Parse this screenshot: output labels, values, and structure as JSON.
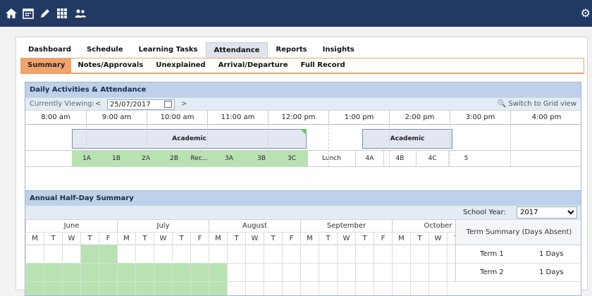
{
  "app": {
    "toolbar_icons": [
      "home-icon",
      "calendar-icon",
      "pencil-icon",
      "grid-icon",
      "people-icon",
      "gear-icon"
    ]
  },
  "tabs": [
    "Dashboard",
    "Schedule",
    "Learning Tasks",
    "Attendance",
    "Reports",
    "Insights"
  ],
  "active_tab": "Attendance",
  "subtabs": [
    "Summary",
    "Notes/Approvals",
    "Unexplained",
    "Arrival/Departure",
    "Full Record"
  ],
  "active_subtab": "Summary",
  "daily": {
    "title": "Daily Activities & Attendance",
    "viewing_label": "Currently Viewing:",
    "prev": "<",
    "next": ">",
    "date_value": "25/07/2017",
    "grid_link": "Switch to Grid view",
    "hours": [
      "8:00 am",
      "9:00 am",
      "10:00 am",
      "11:00 am",
      "12:00 pm",
      "1:00 pm",
      "2:00 pm",
      "3:00 pm",
      "4:00 pm"
    ],
    "blocks": [
      "Academic",
      "Academic"
    ],
    "periods": [
      {
        "label": "1A",
        "attended": true
      },
      {
        "label": "1B",
        "attended": true
      },
      {
        "label": "2A",
        "attended": true
      },
      {
        "label": "2B",
        "attended": true
      },
      {
        "label": "Rec...",
        "attended": true
      },
      {
        "label": "3A",
        "attended": true
      },
      {
        "label": "3B",
        "attended": true
      },
      {
        "label": "3C",
        "attended": true
      },
      {
        "label": "Lunch",
        "attended": false
      },
      {
        "label": "4A",
        "attended": false
      },
      {
        "label": "4B",
        "attended": false
      },
      {
        "label": "4C",
        "attended": false
      },
      {
        "label": "5",
        "attended": false
      }
    ],
    "colors": {
      "attended": "#b9e2b3",
      "block": "#e3e7f2"
    }
  },
  "annual": {
    "title": "Annual Half-Day Summary",
    "school_year_label": "School Year:",
    "school_year_value": "2017",
    "months": [
      "June",
      "July",
      "August",
      "September",
      "October"
    ],
    "weekdays": [
      "M",
      "T",
      "W",
      "T",
      "F"
    ],
    "term_summary_title": "Term Summary (Days Absent)",
    "terms": [
      {
        "name": "Term 1",
        "value": "1 Days"
      },
      {
        "name": "Term 2",
        "value": "1 Days"
      }
    ]
  }
}
